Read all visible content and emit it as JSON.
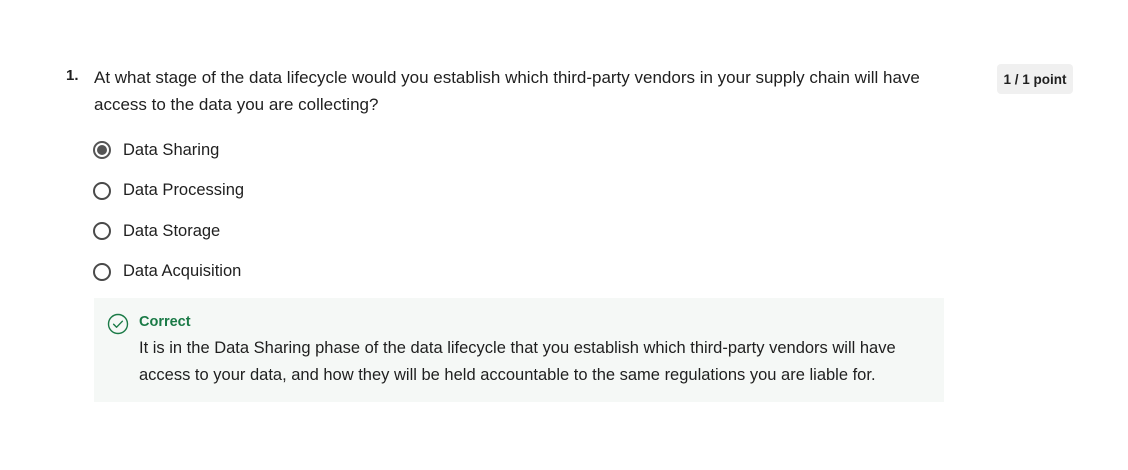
{
  "question": {
    "number": "1.",
    "text": "At what stage of the data lifecycle would you establish which third-party vendors in your supply chain will have access to the data you are collecting?",
    "points": "1 / 1 point"
  },
  "options": [
    {
      "label": "Data Sharing",
      "selected": true
    },
    {
      "label": "Data Processing",
      "selected": false
    },
    {
      "label": "Data Storage",
      "selected": false
    },
    {
      "label": "Data Acquisition",
      "selected": false
    }
  ],
  "feedback": {
    "status": "Correct",
    "icon": "check-circle-icon",
    "text": "It is in the Data Sharing phase of the data lifecycle that you establish which third-party vendors will have access to your data, and how they will be held accountable to the same regulations you are liable for.",
    "color": "#1a7a46",
    "background": "#f5f8f6"
  }
}
